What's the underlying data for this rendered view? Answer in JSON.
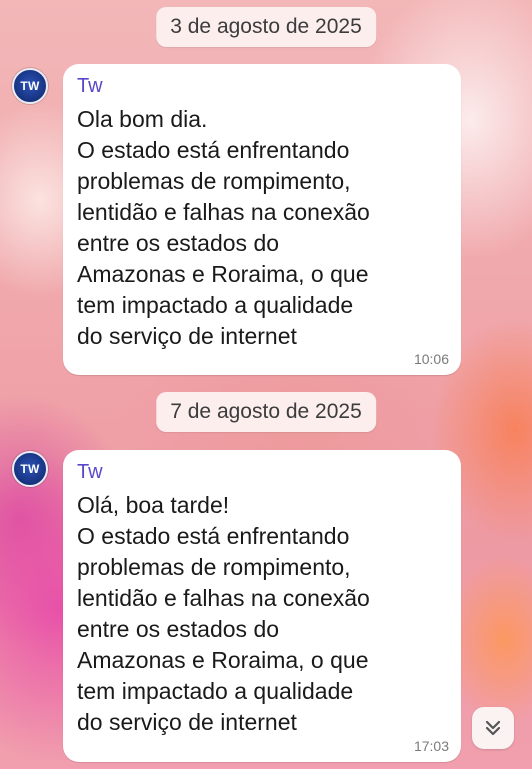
{
  "chat": {
    "messages": [
      {
        "date_separator": "3 de agosto de 2025",
        "avatar_text": "TW",
        "sender": "Tw",
        "lines": [
          "Ola bom dia.",
          "O estado está enfrentando",
          "problemas de rompimento,",
          "lentidão e falhas na conexão",
          "entre os estados do",
          "Amazonas e Roraima, o que",
          "tem impactado a qualidade",
          "do serviço de internet"
        ],
        "time": "10:06"
      },
      {
        "date_separator": "7 de agosto de 2025",
        "avatar_text": "TW",
        "sender": "Tw",
        "lines": [
          "Olá, boa tarde!",
          "O estado está enfrentando",
          "problemas de rompimento,",
          "lentidão e falhas na conexão",
          "entre os estados do",
          "Amazonas e Roraima, o que",
          "tem impactado a qualidade",
          "do serviço de internet"
        ],
        "time": "17:03"
      }
    ],
    "scroll_down_icon": "double-chevron-down-icon"
  },
  "colors": {
    "sender_name": "#5a47c9",
    "bubble": "#ffffff",
    "date_chip": "#fbeeed"
  }
}
